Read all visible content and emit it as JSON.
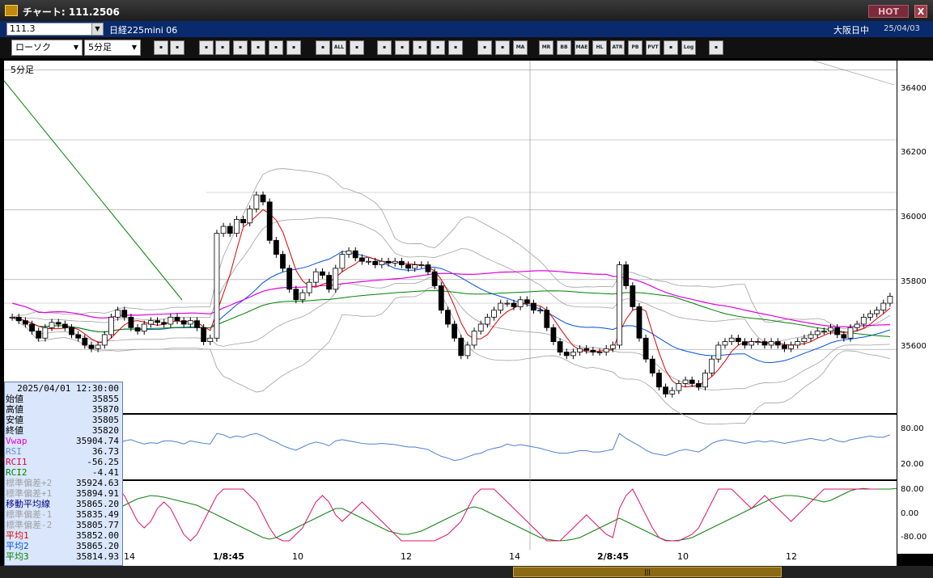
{
  "window": {
    "title": "チャート: 111.2506",
    "hot_label": "HOT",
    "close_label": "X"
  },
  "info": {
    "code": "111.3",
    "instrument": "日経225mini 06",
    "session": "大阪日中",
    "date": "25/04/03"
  },
  "toolbar": {
    "chart_type": "ローソク",
    "timeframe": "5分足",
    "icons": [
      "zoom-icon",
      "window-icon",
      "draw-line-icon",
      "cursor-icon",
      "undo-icon",
      "memo-icon",
      "trash-icon",
      "candle-icon",
      "bar-icon",
      "all-icon",
      "fit-icon",
      "search-icon",
      "chart-icon",
      "arrows-icon",
      "info-icon",
      "settings-icon",
      "paint-icon",
      "color-icon",
      "ma-icon",
      "mr-icon",
      "bb-icon",
      "mae-icon",
      "hl-icon",
      "atr-icon",
      "pb-icon",
      "pvt-icon",
      "box-icon",
      "log-icon",
      "export-icon"
    ],
    "icon_labels": [
      "",
      "",
      "",
      "",
      "",
      "",
      "",
      "",
      "",
      "ALL",
      "",
      "",
      "",
      "",
      "",
      "",
      "",
      "",
      "MA",
      "MR",
      "BB",
      "MAE",
      "HL",
      "ATR",
      "PB",
      "PVT",
      "",
      "Log",
      ""
    ]
  },
  "chart": {
    "timeframe_label": "5分足"
  },
  "price_axis": [
    "36400",
    "36200",
    "36000",
    "35800",
    "35600"
  ],
  "rsi_axis": [
    "80.00",
    "20.00"
  ],
  "rci_axis": [
    "80.00",
    "0.00",
    "-80.00"
  ],
  "time_axis": [
    "14",
    "1/8:45",
    "10",
    "12",
    "14",
    "2/8:45",
    "10",
    "12"
  ],
  "data_panel": {
    "datetime": "2025/04/01 12:30:00",
    "rows": [
      {
        "label": "始値",
        "value": "35855",
        "color": "#000000"
      },
      {
        "label": "高値",
        "value": "35870",
        "color": "#000000"
      },
      {
        "label": "安値",
        "value": "35805",
        "color": "#000000"
      },
      {
        "label": "終値",
        "value": "35820",
        "color": "#000000"
      },
      {
        "label": "Vwap",
        "value": "35904.74",
        "color": "#e000e0"
      },
      {
        "label": "RSI",
        "value": "36.73",
        "color": "#6a8cd0"
      },
      {
        "label": "RCI1",
        "value": "-56.25",
        "color": "#e00040"
      },
      {
        "label": "RCI2",
        "value": "-4.41",
        "color": "#008000"
      },
      {
        "label": "標準偏差+2",
        "value": "35924.63",
        "color": "#a0a0a0"
      },
      {
        "label": "標準偏差+1",
        "value": "35894.91",
        "color": "#a0a0a0"
      },
      {
        "label": "移動平均線",
        "value": "35865.20",
        "color": "#000080"
      },
      {
        "label": "標準偏差-1",
        "value": "35835.49",
        "color": "#a0a0a0"
      },
      {
        "label": "標準偏差-2",
        "value": "35805.77",
        "color": "#a0a0a0"
      },
      {
        "label": "平均1",
        "value": "35852.00",
        "color": "#e00000"
      },
      {
        "label": "平均2",
        "value": "35865.20",
        "color": "#0050e0"
      },
      {
        "label": "平均3",
        "value": "35814.93",
        "color": "#008000"
      }
    ]
  },
  "colors": {
    "vwap": "#e000e0",
    "ma1": "#e00000",
    "ma2": "#0050e0",
    "ma3": "#008000",
    "rsi": "#4a80d0",
    "rci1": "#e0106a",
    "rci2": "#108010",
    "bb": "#a0a0a0"
  },
  "chart_data": {
    "type": "candlestick",
    "ylim": [
      35450,
      36450
    ],
    "closes": [
      35720,
      35710,
      35700,
      35680,
      35660,
      35690,
      35705,
      35700,
      35690,
      35670,
      35660,
      35640,
      35630,
      35640,
      35670,
      35720,
      35740,
      35720,
      35690,
      35680,
      35700,
      35710,
      35705,
      35700,
      35720,
      35710,
      35700,
      35710,
      35690,
      35650,
      35660,
      35960,
      35980,
      35960,
      36000,
      35990,
      36030,
      36070,
      36050,
      35940,
      35900,
      35860,
      35800,
      35770,
      35790,
      35820,
      35850,
      35840,
      35800,
      35860,
      35900,
      35910,
      35890,
      35880,
      35880,
      35870,
      35880,
      35875,
      35880,
      35870,
      35860,
      35870,
      35870,
      35850,
      35810,
      35740,
      35700,
      35660,
      35610,
      35640,
      35680,
      35700,
      35720,
      35740,
      35760,
      35760,
      35750,
      35770,
      35760,
      35740,
      35740,
      35690,
      35650,
      35620,
      35610,
      35620,
      35630,
      35625,
      35620,
      35620,
      35630,
      35640,
      35870,
      35810,
      35750,
      35660,
      35600,
      35560,
      35520,
      35500,
      35510,
      35530,
      35540,
      35530,
      35520,
      35560,
      35600,
      35640,
      35650,
      35660,
      35650,
      35640,
      35650,
      35650,
      35640,
      35650,
      35640,
      35630,
      35640,
      35650,
      35660,
      35670,
      35680,
      35680,
      35690,
      35670,
      35660,
      35690,
      35700,
      35720,
      35730,
      35740,
      35760,
      35780
    ],
    "rsi": [
      62,
      60,
      58,
      55,
      57,
      59,
      60,
      58,
      55,
      52,
      50,
      55,
      60,
      62,
      60,
      58,
      55,
      60,
      62,
      58,
      55,
      57,
      56,
      60,
      60,
      58,
      55,
      60,
      58,
      56,
      55,
      72,
      70,
      65,
      68,
      66,
      70,
      72,
      68,
      62,
      58,
      52,
      48,
      45,
      50,
      55,
      58,
      56,
      52,
      60,
      62,
      60,
      58,
      56,
      55,
      55,
      56,
      55,
      54,
      52,
      50,
      50,
      48,
      46,
      40,
      35,
      32,
      28,
      30,
      34,
      38,
      40,
      45,
      48,
      50,
      55,
      52,
      54,
      52,
      50,
      48,
      45,
      42,
      40,
      40,
      42,
      44,
      44,
      42,
      42,
      44,
      46,
      72,
      64,
      58,
      52,
      45,
      40,
      38,
      36,
      40,
      44,
      46,
      44,
      42,
      48,
      56,
      60,
      62,
      60,
      58,
      56,
      58,
      60,
      58,
      60,
      58,
      56,
      58,
      60,
      62,
      64,
      62,
      60,
      64,
      60,
      58,
      62,
      64,
      66,
      68,
      66,
      66,
      70
    ],
    "rci1": [
      20,
      0,
      -40,
      -60,
      -40,
      -10,
      20,
      40,
      20,
      -20,
      -60,
      -80,
      -60,
      -20,
      20,
      60,
      80,
      60,
      20,
      -20,
      -40,
      -20,
      20,
      40,
      20,
      -20,
      -60,
      -80,
      -60,
      -20,
      20,
      60,
      80,
      80,
      80,
      80,
      60,
      40,
      0,
      -40,
      -70,
      -80,
      -80,
      -60,
      -40,
      0,
      40,
      60,
      40,
      0,
      -20,
      0,
      20,
      40,
      20,
      0,
      -20,
      -40,
      -60,
      -80,
      -80,
      -80,
      -80,
      -80,
      -80,
      -70,
      -60,
      -40,
      -20,
      20,
      60,
      80,
      80,
      80,
      60,
      40,
      20,
      0,
      -20,
      -40,
      -60,
      -80,
      -80,
      -80,
      -60,
      -40,
      -20,
      0,
      -20,
      -40,
      -60,
      -70,
      20,
      60,
      80,
      40,
      0,
      -40,
      -70,
      -80,
      -80,
      -80,
      -70,
      -60,
      -40,
      0,
      40,
      80,
      80,
      80,
      60,
      40,
      20,
      40,
      60,
      40,
      20,
      0,
      -20,
      0,
      20,
      40,
      60,
      80,
      80,
      80,
      80,
      80,
      80,
      80,
      80,
      80
    ],
    "rci2": [
      40,
      50,
      55,
      60,
      60,
      55,
      50,
      40,
      30,
      20,
      10,
      0,
      -10,
      -10,
      0,
      10,
      20,
      30,
      40,
      50,
      55,
      60,
      58,
      55,
      50,
      45,
      40,
      35,
      30,
      20,
      10,
      0,
      -10,
      -20,
      -30,
      -40,
      -50,
      -60,
      -70,
      -75,
      -70,
      -60,
      -50,
      -40,
      -30,
      -20,
      -10,
      0,
      10,
      20,
      20,
      10,
      0,
      -10,
      -20,
      -30,
      -40,
      -50,
      -55,
      -60,
      -60,
      -55,
      -50,
      -40,
      -30,
      -20,
      -10,
      0,
      10,
      20,
      25,
      20,
      10,
      0,
      -10,
      -20,
      -30,
      -40,
      -50,
      -60,
      -70,
      -75,
      -78,
      -80,
      -78,
      -75,
      -70,
      -60,
      -50,
      -40,
      -30,
      -20,
      -10,
      -20,
      -30,
      -40,
      -50,
      -60,
      -70,
      -78,
      -80,
      -78,
      -75,
      -70,
      -60,
      -50,
      -40,
      -30,
      -20,
      -10,
      0,
      10,
      20,
      30,
      40,
      50,
      55,
      60,
      60,
      58,
      55,
      50,
      45,
      40,
      45,
      55,
      65,
      75,
      80,
      82,
      80,
      80,
      80,
      80,
      82,
      84
    ]
  }
}
